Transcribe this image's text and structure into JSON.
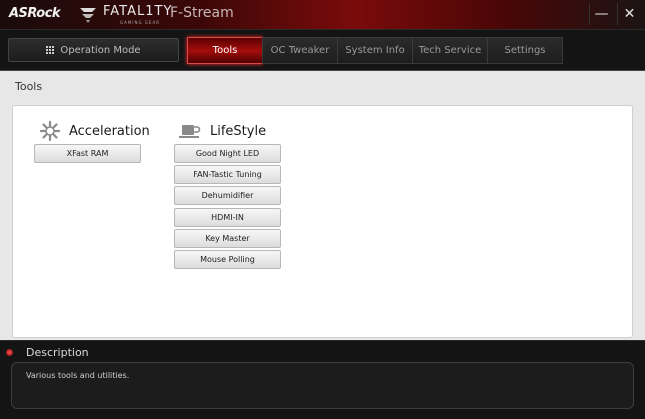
{
  "titlebar": {
    "brand": "ASRock",
    "fatality_text": "FATAL1TY",
    "fatality_sub": "GAMING GEAR",
    "app_title": "F-Stream",
    "minimize": "—",
    "close": "✕"
  },
  "nav": {
    "operation_mode": "Operation Mode",
    "tabs": [
      {
        "label": "Tools"
      },
      {
        "label": "OC Tweaker"
      },
      {
        "label": "System Info"
      },
      {
        "label": "Tech Service"
      },
      {
        "label": "Settings"
      }
    ],
    "active_tab": "Tools"
  },
  "section": {
    "title": "Tools",
    "groups": [
      {
        "title": "Acceleration",
        "icon": "gear-icon",
        "items": [
          "XFast RAM"
        ]
      },
      {
        "title": "LifeStyle",
        "icon": "coffee-cup-icon",
        "items": [
          "Good Night LED",
          "FAN-Tastic Tuning",
          "Dehumidifier",
          "HDMI-IN",
          "Key Master",
          "Mouse Polling"
        ]
      }
    ]
  },
  "description": {
    "title": "Description",
    "text": "Various tools and utilities."
  },
  "colors": {
    "accent": "#a50d0d",
    "titlebar_red": "#7a0b0b",
    "panel_bg": "#e7e7e7"
  }
}
